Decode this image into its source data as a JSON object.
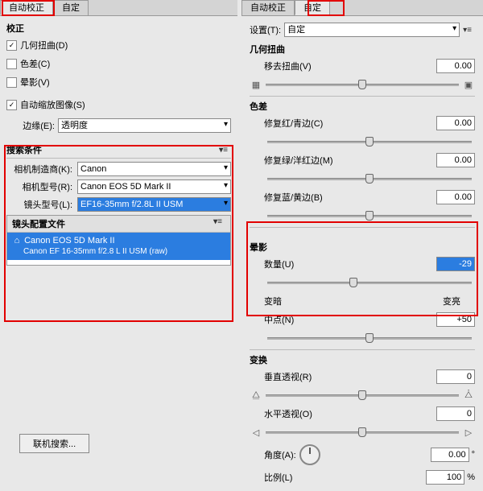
{
  "tabs_left": {
    "auto": "自动校正",
    "custom": "自定"
  },
  "tabs_right": {
    "auto": "自动校正",
    "custom": "自定"
  },
  "left": {
    "correction": "校正",
    "geom": "几何扭曲(D)",
    "chroma": "色差(C)",
    "vignette": "晕影(V)",
    "autoscale": "自动缩放图像(S)",
    "edge": "边缘(E):",
    "edge_val": "透明度",
    "search": "搜索条件",
    "maker": "相机制造商(K):",
    "maker_val": "Canon",
    "model": "相机型号(R):",
    "model_val": "Canon EOS 5D Mark II",
    "lens": "镜头型号(L):",
    "lens_val": "EF16-35mm f/2.8L II USM",
    "profiles": "镜头配置文件",
    "profile_line1": "Canon EOS 5D Mark II",
    "profile_line2": "Canon EF 16-35mm f/2.8 L II USM (raw)",
    "online": "联机搜索..."
  },
  "right": {
    "setting": "设置(T):",
    "setting_val": "自定",
    "geom": "几何扭曲",
    "remove": "移去扭曲(V)",
    "remove_val": "0.00",
    "chroma": "色差",
    "rc": "修复红/青边(C)",
    "rc_val": "0.00",
    "gm": "修复绿/洋红边(M)",
    "gm_val": "0.00",
    "by": "修复蓝/黄边(B)",
    "by_val": "0.00",
    "vignette": "晕影",
    "amount": "数量(U)",
    "amount_val": "-29",
    "darker": "变暗",
    "lighter": "变亮",
    "midpoint": "中点(N)",
    "midpoint_val": "+50",
    "transform": "变换",
    "vpersp": "垂直透视(R)",
    "vpersp_val": "0",
    "hpersp": "水平透视(O)",
    "hpersp_val": "0",
    "angle": "角度(A):",
    "angle_val": "0.00",
    "angle_unit": "°",
    "scale": "比例(L)",
    "scale_val": "100",
    "scale_unit": "%"
  }
}
